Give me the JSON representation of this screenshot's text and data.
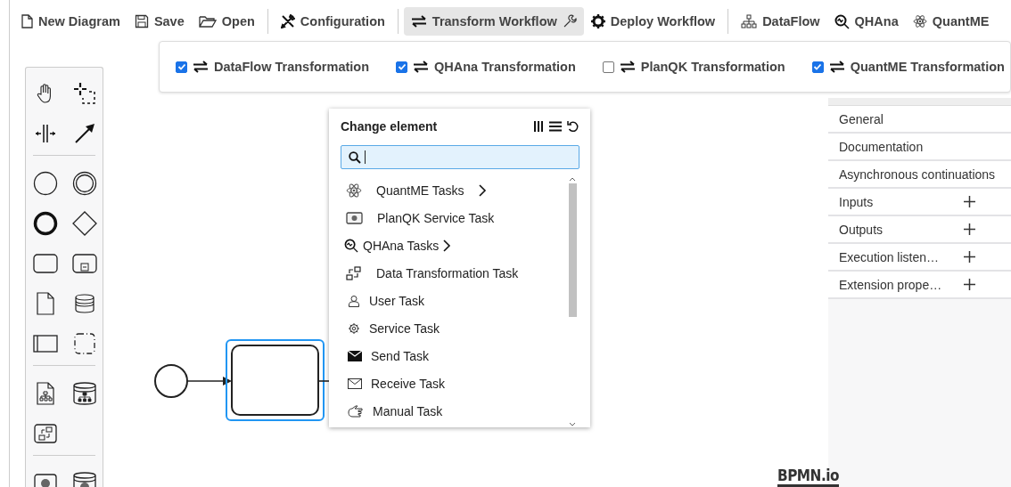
{
  "toolbar": {
    "groups": [
      [
        {
          "label": "New Diagram",
          "selected": false
        },
        {
          "label": "Save",
          "selected": false
        },
        {
          "label": "Open",
          "selected": false
        }
      ],
      [
        {
          "label": "Configuration",
          "selected": false
        }
      ],
      [
        {
          "label": "Transform Workflow",
          "selected": true
        },
        {
          "label": "Deploy Workflow",
          "selected": false
        }
      ],
      [
        {
          "label": "DataFlow",
          "selected": false
        },
        {
          "label": "QHAna",
          "selected": false
        },
        {
          "label": "QuantME",
          "selected": false
        }
      ]
    ]
  },
  "transform_options": [
    {
      "label": "DataFlow Transformation",
      "checked": true
    },
    {
      "label": "QHAna Transformation",
      "checked": true
    },
    {
      "label": "PlanQK Transformation",
      "checked": false
    },
    {
      "label": "QuantME Transformation",
      "checked": true
    }
  ],
  "change_element": {
    "title": "Change element",
    "items": [
      {
        "label": "QuantME Tasks",
        "submenu": true
      },
      {
        "label": "PlanQK Service Task",
        "submenu": false
      },
      {
        "label": "QHAna Tasks",
        "submenu": true
      },
      {
        "label": "Data Transformation Task",
        "submenu": false
      },
      {
        "label": "User Task",
        "submenu": false
      },
      {
        "label": "Service Task",
        "submenu": false
      },
      {
        "label": "Send Task",
        "submenu": false
      },
      {
        "label": "Receive Task",
        "submenu": false
      },
      {
        "label": "Manual Task",
        "submenu": false
      }
    ]
  },
  "properties": [
    {
      "label": "General",
      "addable": false
    },
    {
      "label": "Documentation",
      "addable": false
    },
    {
      "label": "Asynchronous continuations",
      "addable": false
    },
    {
      "label": "Inputs",
      "addable": true
    },
    {
      "label": "Outputs",
      "addable": true
    },
    {
      "label": "Execution listen…",
      "addable": true
    },
    {
      "label": "Extension prope…",
      "addable": true
    }
  ],
  "canvas": {
    "task_selected": true
  },
  "logo": "BPMN.io"
}
